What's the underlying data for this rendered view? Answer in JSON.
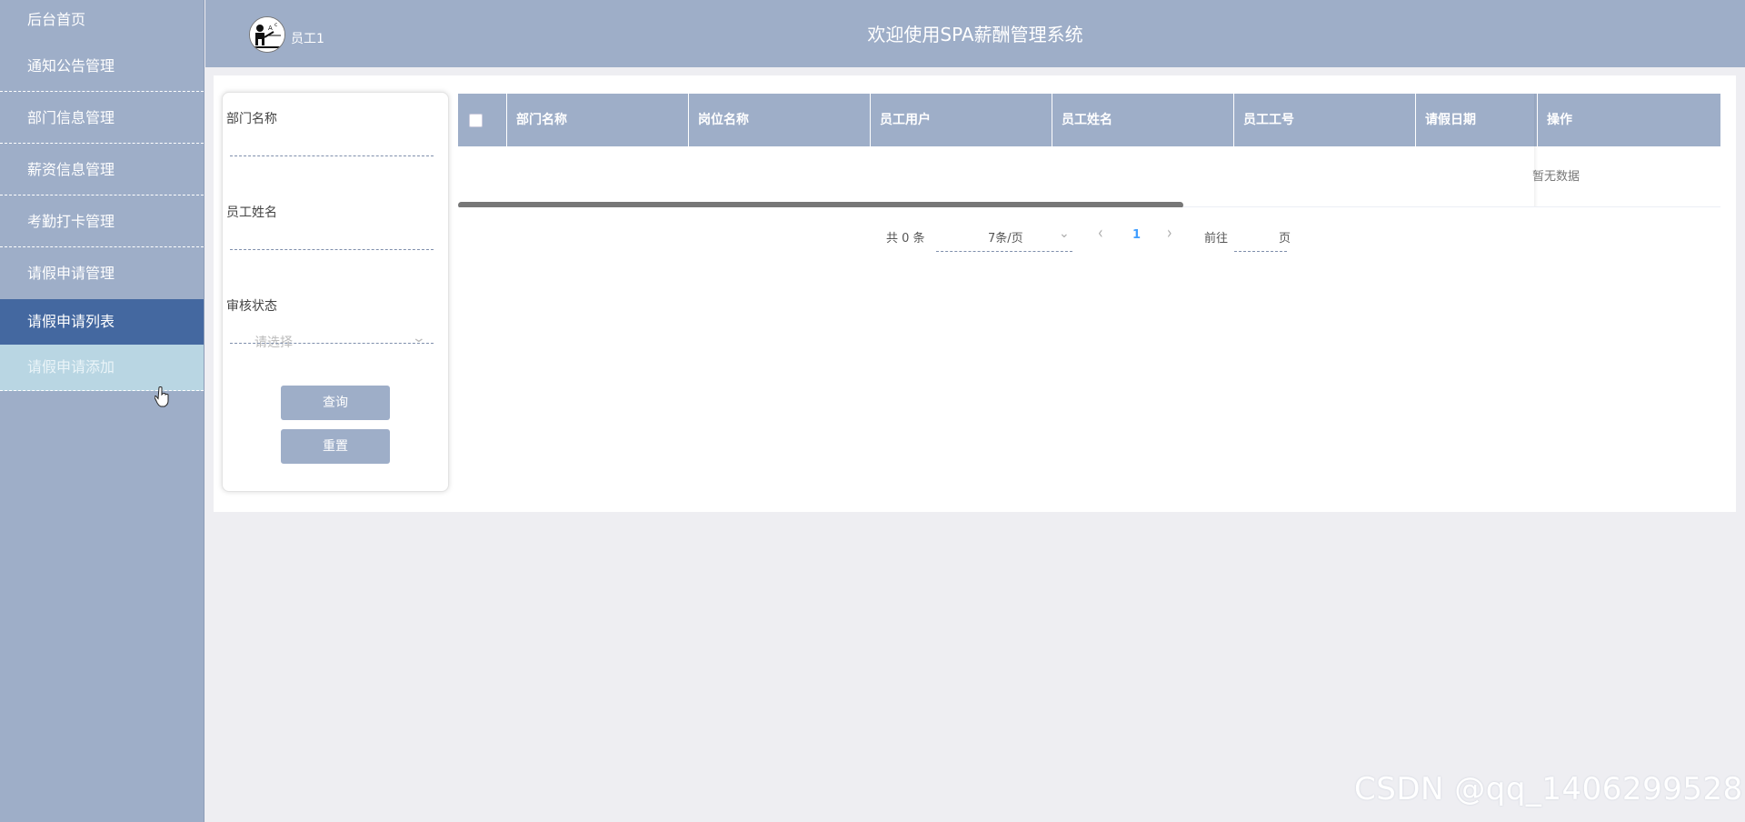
{
  "sidebar": {
    "items": [
      {
        "label": "后台首页"
      },
      {
        "label": "通知公告管理"
      },
      {
        "label": "部门信息管理"
      },
      {
        "label": "薪资信息管理"
      },
      {
        "label": "考勤打卡管理"
      },
      {
        "label": "请假申请管理"
      }
    ],
    "sub_items": [
      {
        "label": "请假申请列表"
      },
      {
        "label": "请假申请添加"
      }
    ]
  },
  "header": {
    "user_name": "员工1",
    "title": "欢迎使用SPA薪酬管理系统"
  },
  "search": {
    "dept_label": "部门名称",
    "name_label": "员工姓名",
    "status_label": "审核状态",
    "status_placeholder": "请选择",
    "query_button": "查询",
    "reset_button": "重置"
  },
  "table": {
    "columns": [
      "部门名称",
      "岗位名称",
      "员工用户",
      "员工姓名",
      "员工工号",
      "请假日期",
      "操作"
    ],
    "empty_text": "暂无数据"
  },
  "pagination": {
    "total": "共 0 条",
    "page_size": "7条/页",
    "current_page": "1",
    "goto_prefix": "前往",
    "goto_suffix": "页"
  },
  "watermark": "CSDN @qq_1406299528",
  "colors": {
    "sidebar_bg": "#9eaec8",
    "active_item": "#4468a0",
    "hover_item": "#b9d6e3",
    "page_active": "#409eff"
  }
}
